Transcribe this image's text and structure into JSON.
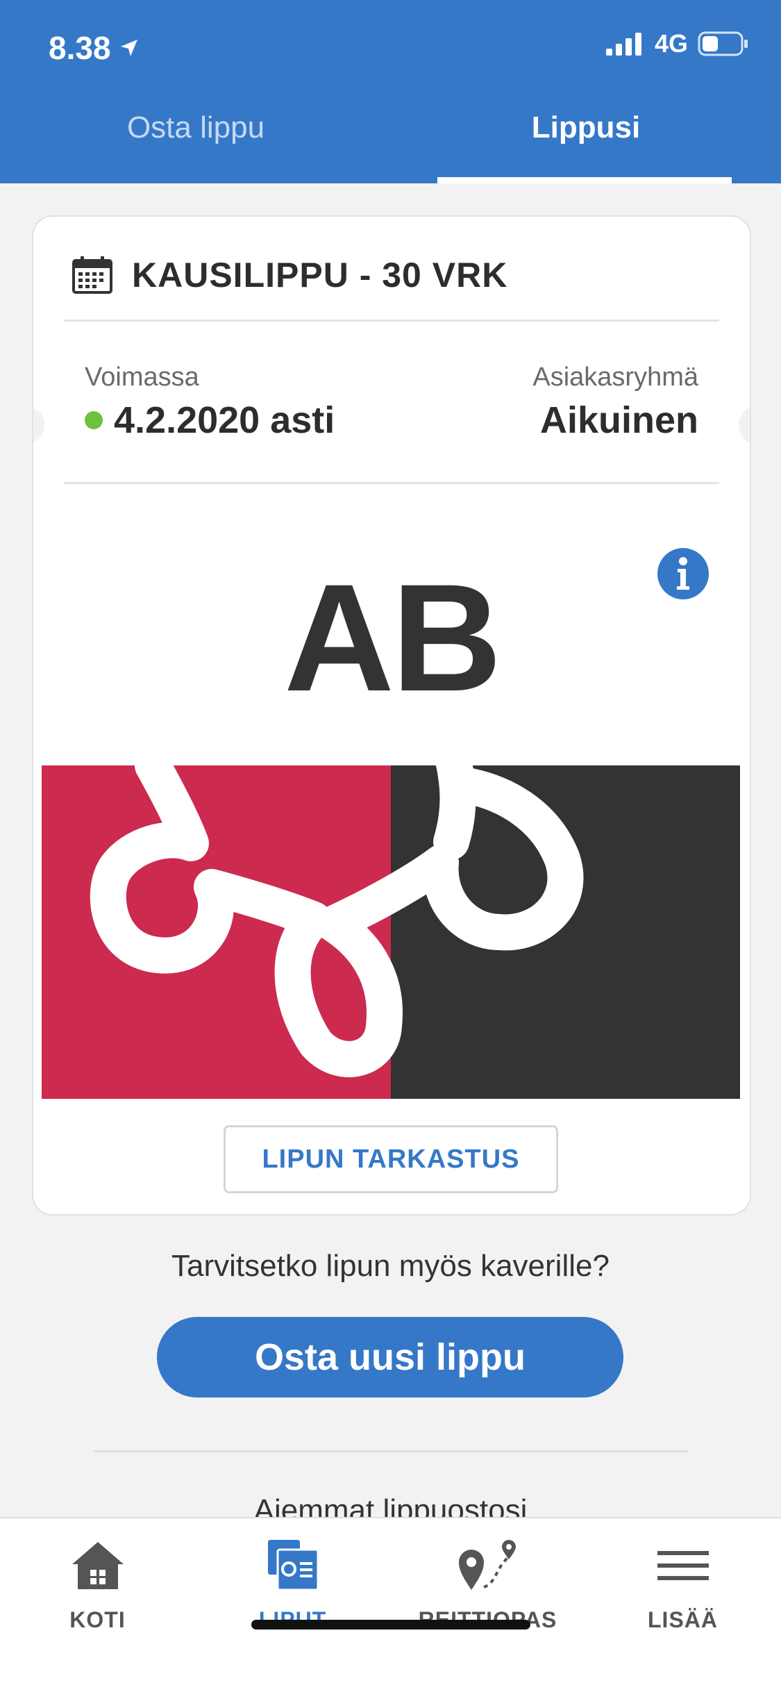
{
  "status_bar": {
    "time": "8.38",
    "network": "4G"
  },
  "tabs": [
    {
      "label": "Osta lippu",
      "active": false
    },
    {
      "label": "Lippusi",
      "active": true
    }
  ],
  "ticket": {
    "title": "KAUSILIPPU - 30 VRK",
    "validity_label": "Voimassa",
    "validity_value": "4.2.2020 asti",
    "customer_group_label": "Asiakasryhmä",
    "customer_group_value": "Aikuinen",
    "zone": "AB",
    "check_button_label": "LIPUN TARKASTUS"
  },
  "prompt": {
    "question": "Tarvitsetko lipun myös kaverille?",
    "buy_button_label": "Osta uusi lippu"
  },
  "history_link": "Aiemmat lippuostosi",
  "bottom_nav": [
    {
      "label": "KOTI",
      "icon": "home-icon",
      "active": false
    },
    {
      "label": "LIPUT",
      "icon": "tickets-icon",
      "active": true
    },
    {
      "label": "REITTIOPAS",
      "icon": "route-icon",
      "active": false
    },
    {
      "label": "LISÄÄ",
      "icon": "menu-icon",
      "active": false
    }
  ],
  "colors": {
    "brand_blue": "#3578c8",
    "ticket_red": "#cc2a4f",
    "ticket_dark": "#333333",
    "valid_green": "#70c040"
  }
}
